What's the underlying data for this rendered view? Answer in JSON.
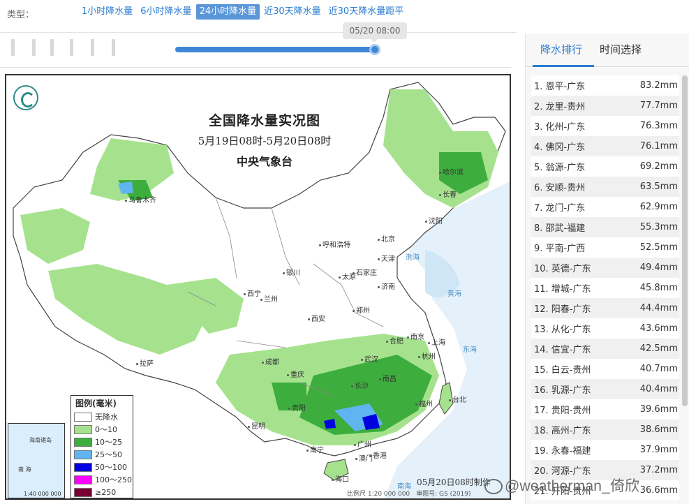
{
  "typebar": {
    "label": "类型：",
    "tabs": [
      {
        "label": "1小时降水量",
        "active": false
      },
      {
        "label": "6小时降水量",
        "active": false
      },
      {
        "label": "24小时降水量",
        "active": true
      },
      {
        "label": "近30天降水量",
        "active": false
      },
      {
        "label": "近30天降水量距平",
        "active": false
      }
    ]
  },
  "timeline": {
    "current_time": "05/20 08:00",
    "progress": 1.0
  },
  "map": {
    "title": "全国降水量实况图",
    "period": "5月19日08时-5月20日08时",
    "agency": "中央气象台",
    "made_time": "05月20日08时制作",
    "scale_note": "比例尺 1:20 000 000　审图号: GS (2019)",
    "cities": [
      "乌鲁木齐",
      "哈尔滨",
      "长春",
      "沈阳",
      "北京",
      "天津",
      "呼和浩特",
      "银川",
      "太原",
      "石家庄",
      "济南",
      "西宁",
      "兰州",
      "郑州",
      "西安",
      "南京",
      "合肥",
      "上海",
      "武汉",
      "杭州",
      "拉萨",
      "成都",
      "重庆",
      "长沙",
      "南昌",
      "福州",
      "台北",
      "贵阳",
      "昆明",
      "南宁",
      "广州",
      "香港",
      "澳门",
      "海口"
    ],
    "seas": [
      "渤海",
      "黄海",
      "东海",
      "南海"
    ],
    "legend": {
      "title": "图例(毫米)",
      "items": [
        {
          "label": "无降水",
          "color": "#ffffff"
        },
        {
          "label": "0～10",
          "color": "#a6e28e"
        },
        {
          "label": "10～25",
          "color": "#3dae3d"
        },
        {
          "label": "25～50",
          "color": "#60b4f0"
        },
        {
          "label": "50～100",
          "color": "#0000e0"
        },
        {
          "label": "100～250",
          "color": "#ff00ff"
        },
        {
          "label": "≥250",
          "color": "#7a0034"
        }
      ]
    },
    "inset": {
      "label1": "海南诸岛",
      "label2": "南 海",
      "scale": "1:40 000 000"
    }
  },
  "watermark": "@weatherman_倚欣",
  "right_panel": {
    "tabs": [
      {
        "label": "降水排行",
        "active": true
      },
      {
        "label": "时间选择",
        "active": false
      }
    ],
    "rankings": [
      {
        "name": "1. 恩平-广东",
        "value": "83.2mm"
      },
      {
        "name": "2. 龙里-贵州",
        "value": "77.7mm"
      },
      {
        "name": "3. 化州-广东",
        "value": "76.3mm"
      },
      {
        "name": "4. 佛冈-广东",
        "value": "76.1mm"
      },
      {
        "name": "5. 翁源-广东",
        "value": "69.2mm"
      },
      {
        "name": "6. 安顺-贵州",
        "value": "63.5mm"
      },
      {
        "name": "7. 龙门-广东",
        "value": "62.9mm"
      },
      {
        "name": "8. 邵武-福建",
        "value": "55.3mm"
      },
      {
        "name": "9. 平南-广西",
        "value": "52.5mm"
      },
      {
        "name": "10. 英德-广东",
        "value": "49.4mm"
      },
      {
        "name": "11. 增城-广东",
        "value": "45.8mm"
      },
      {
        "name": "12. 阳春-广东",
        "value": "44.4mm"
      },
      {
        "name": "13. 从化-广东",
        "value": "43.6mm"
      },
      {
        "name": "14. 信宜-广东",
        "value": "42.5mm"
      },
      {
        "name": "15. 白云-贵州",
        "value": "40.7mm"
      },
      {
        "name": "16. 乳源-广东",
        "value": "40.4mm"
      },
      {
        "name": "17. 贵阳-贵州",
        "value": "39.6mm"
      },
      {
        "name": "18. 高州-广东",
        "value": "38.6mm"
      },
      {
        "name": "19. 永春-福建",
        "value": "37.9mm"
      },
      {
        "name": "20. 河源-广东",
        "value": "37.2mm"
      },
      {
        "name": "21. 开阳-贵州",
        "value": "36.6mm"
      }
    ]
  }
}
